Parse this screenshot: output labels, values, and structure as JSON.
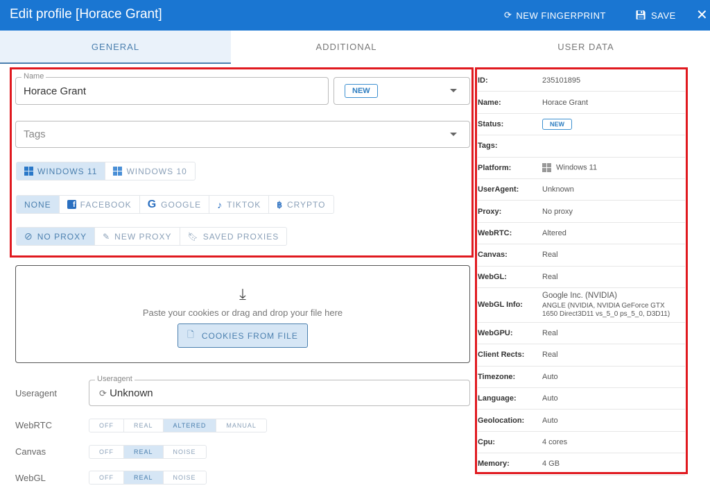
{
  "header": {
    "title": "Edit profile [Horace Grant]",
    "new_fingerprint": "NEW FINGERPRINT",
    "save": "SAVE"
  },
  "tabs": [
    {
      "label": "GENERAL",
      "active": true
    },
    {
      "label": "ADDITIONAL"
    },
    {
      "label": "USER DATA"
    }
  ],
  "form": {
    "name_label": "Name",
    "name_value": "Horace Grant",
    "status_value": "NEW",
    "tags_placeholder": "Tags",
    "os": [
      {
        "label": "WINDOWS 11",
        "selected": true
      },
      {
        "label": "WINDOWS 10"
      }
    ],
    "templates": [
      {
        "label": "NONE",
        "selected": true
      },
      {
        "label": "FACEBOOK"
      },
      {
        "label": "GOOGLE"
      },
      {
        "label": "TIKTOK"
      },
      {
        "label": "CRYPTO"
      }
    ],
    "proxy": [
      {
        "label": "NO PROXY",
        "selected": true
      },
      {
        "label": "NEW PROXY"
      },
      {
        "label": "SAVED PROXIES"
      }
    ],
    "cookies_hint": "Paste your cookies or drag and drop your file here",
    "cookies_button": "COOKIES FROM FILE",
    "useragent_label": "Useragent",
    "useragent_legend": "Useragent",
    "useragent_value": "Unknown",
    "webrtc": {
      "label": "WebRTC",
      "options": [
        "OFF",
        "REAL",
        "ALTERED",
        "MANUAL"
      ],
      "selected": "ALTERED"
    },
    "canvas": {
      "label": "Canvas",
      "options": [
        "OFF",
        "REAL",
        "NOISE"
      ],
      "selected": "REAL"
    },
    "webgl": {
      "label": "WebGL",
      "options": [
        "OFF",
        "REAL",
        "NOISE"
      ],
      "selected": "REAL"
    }
  },
  "summary": [
    {
      "k": "ID:",
      "v": "235101895"
    },
    {
      "k": "Name:",
      "v": "Horace Grant"
    },
    {
      "k": "Status:",
      "v": "NEW"
    },
    {
      "k": "Tags:",
      "v": ""
    },
    {
      "k": "Platform:",
      "v": "Windows 11"
    },
    {
      "k": "UserAgent:",
      "v": "Unknown"
    },
    {
      "k": "Proxy:",
      "v": "No proxy"
    },
    {
      "k": "WebRTC:",
      "v": "Altered"
    },
    {
      "k": "Canvas:",
      "v": "Real"
    },
    {
      "k": "WebGL:",
      "v": "Real"
    },
    {
      "k": "WebGL Info:",
      "v": "Google Inc. (NVIDIA)",
      "v2": "ANGLE (NVIDIA, NVIDIA GeForce GTX 1650 Direct3D11 vs_5_0 ps_5_0, D3D11)"
    },
    {
      "k": "WebGPU:",
      "v": "Real"
    },
    {
      "k": "Client Rects:",
      "v": "Real"
    },
    {
      "k": "Timezone:",
      "v": "Auto"
    },
    {
      "k": "Language:",
      "v": "Auto"
    },
    {
      "k": "Geolocation:",
      "v": "Auto"
    },
    {
      "k": "Cpu:",
      "v": "4 cores"
    },
    {
      "k": "Memory:",
      "v": "4 GB"
    }
  ],
  "colors": {
    "header": "#1a76d2",
    "accent": "#4a7fae",
    "highlight": "#e0191f"
  }
}
